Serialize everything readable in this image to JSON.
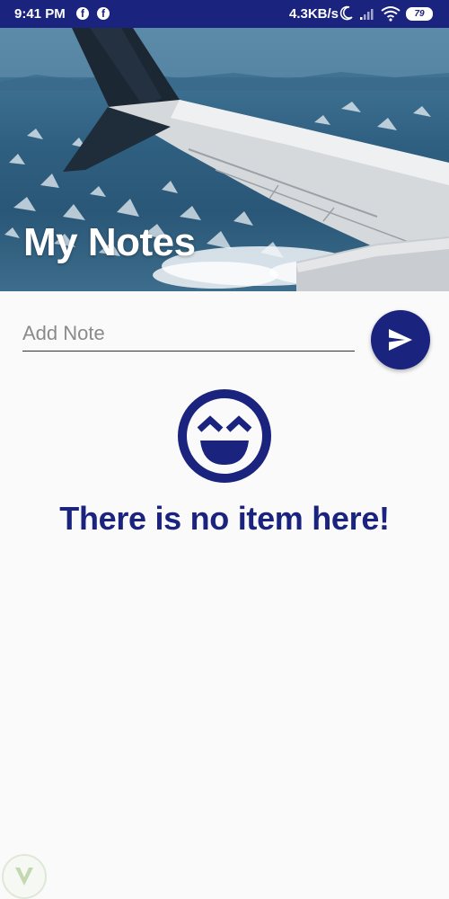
{
  "status_bar": {
    "time": "9:41 PM",
    "network_speed": "4.3KB/s",
    "battery_level": "79",
    "icons": [
      "facebook-icon",
      "facebook-icon",
      "moon-icon",
      "signal-icon",
      "wifi-icon",
      "battery-icon"
    ]
  },
  "header": {
    "title": "My Notes"
  },
  "note_form": {
    "placeholder": "Add Note",
    "value": "",
    "send_icon": "send-icon"
  },
  "empty_state": {
    "icon": "smiley-icon",
    "message": "There is no item here!"
  },
  "colors": {
    "primary": "#1a237e",
    "background": "#fafafa",
    "white": "#ffffff"
  }
}
